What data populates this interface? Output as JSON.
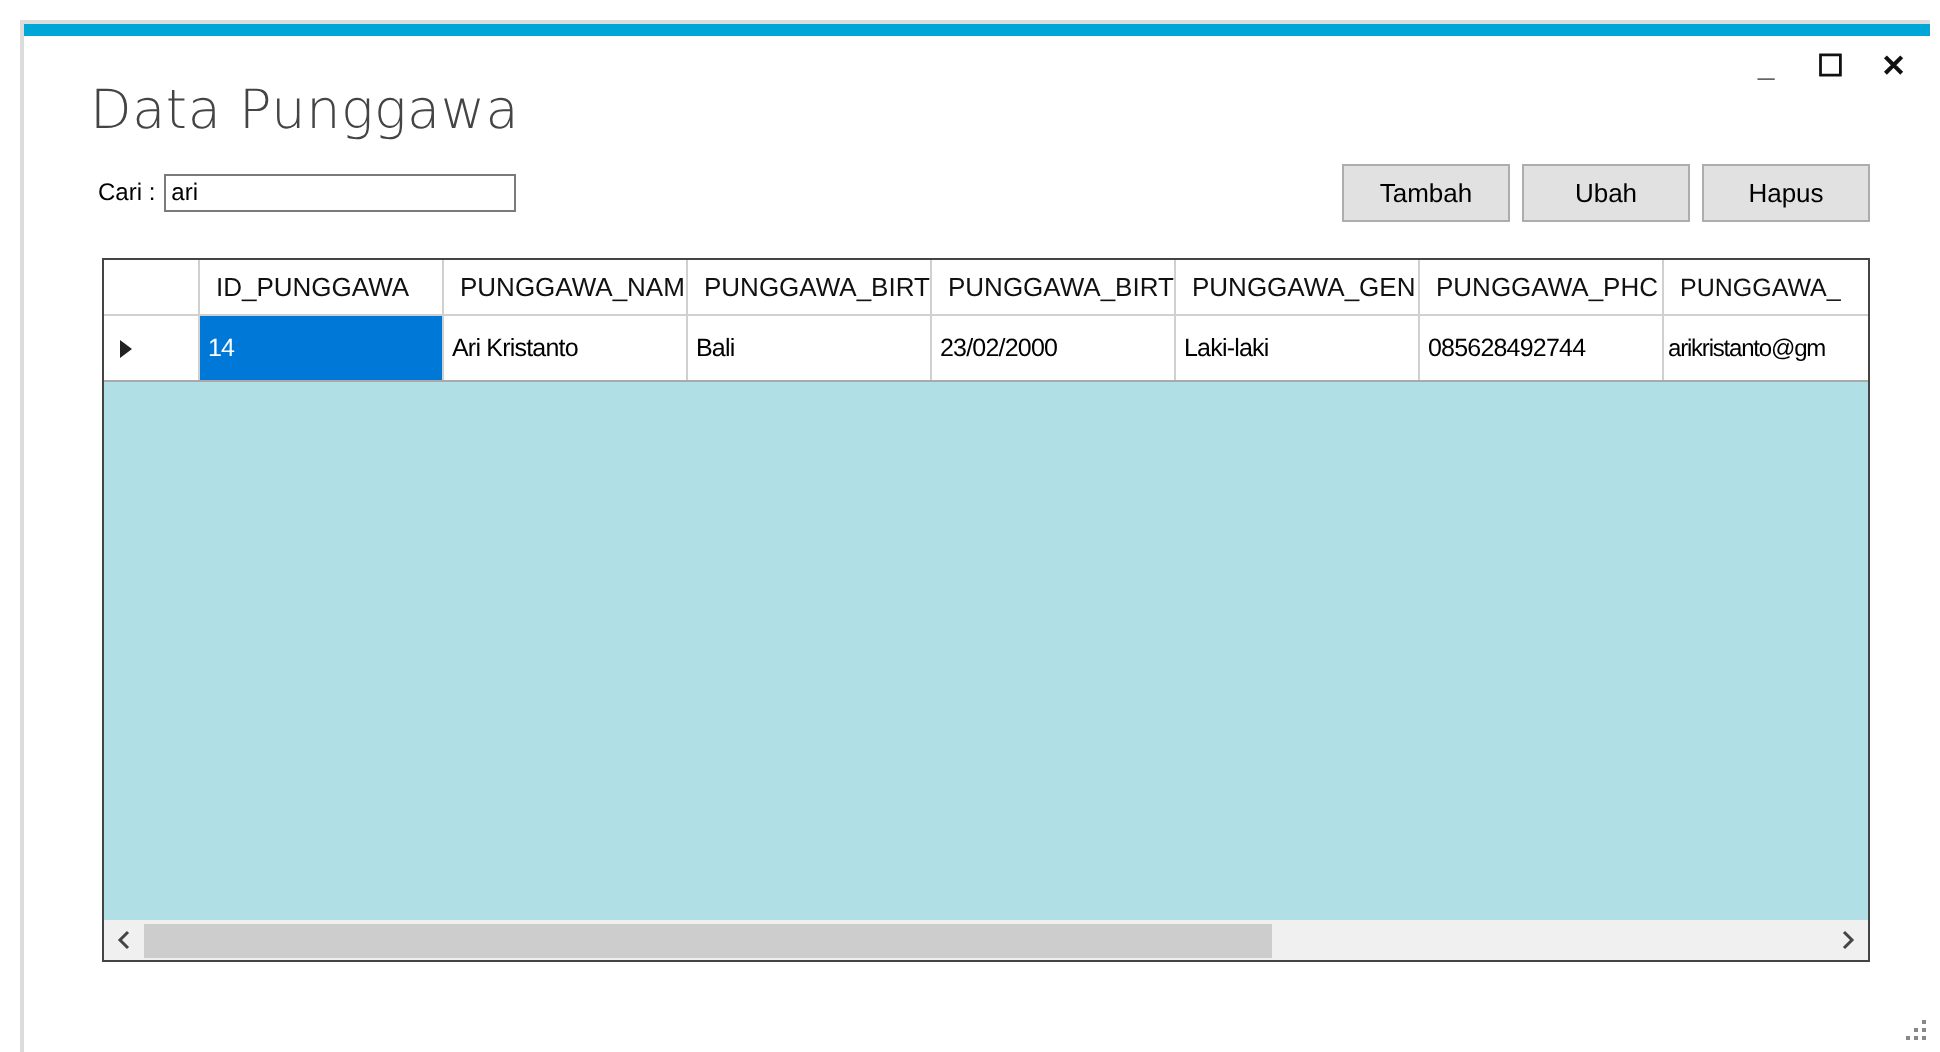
{
  "window": {
    "title": "Data Punggawa",
    "controls": [
      "_",
      "☐",
      "✕"
    ]
  },
  "search": {
    "label": "Cari :",
    "value": "ari"
  },
  "buttons": [
    "Tambah",
    "Ubah",
    "Hapus"
  ],
  "table": {
    "columns": [
      "ID_PUNGGAWA",
      "PUNGGAWA_NAM",
      "PUNGGAWA_BIRT",
      "PUNGGAWA_BIRT",
      "PUNGGAWA_GEN",
      "PUNGGAWA_PHC",
      "PUNGGAWA_"
    ],
    "rows": [
      {
        "current": true,
        "cells": [
          {
            "text": "14",
            "selected": true
          },
          {
            "text": "Ari Kristanto",
            "selected": false
          },
          {
            "text": "Bali",
            "selected": false
          },
          {
            "text": "23/02/2000",
            "selected": false
          },
          {
            "text": "Laki-laki",
            "selected": false
          },
          {
            "text": "085628492744",
            "selected": false
          },
          {
            "text": "arikristanto@gm",
            "selected": false
          }
        ]
      }
    ]
  }
}
